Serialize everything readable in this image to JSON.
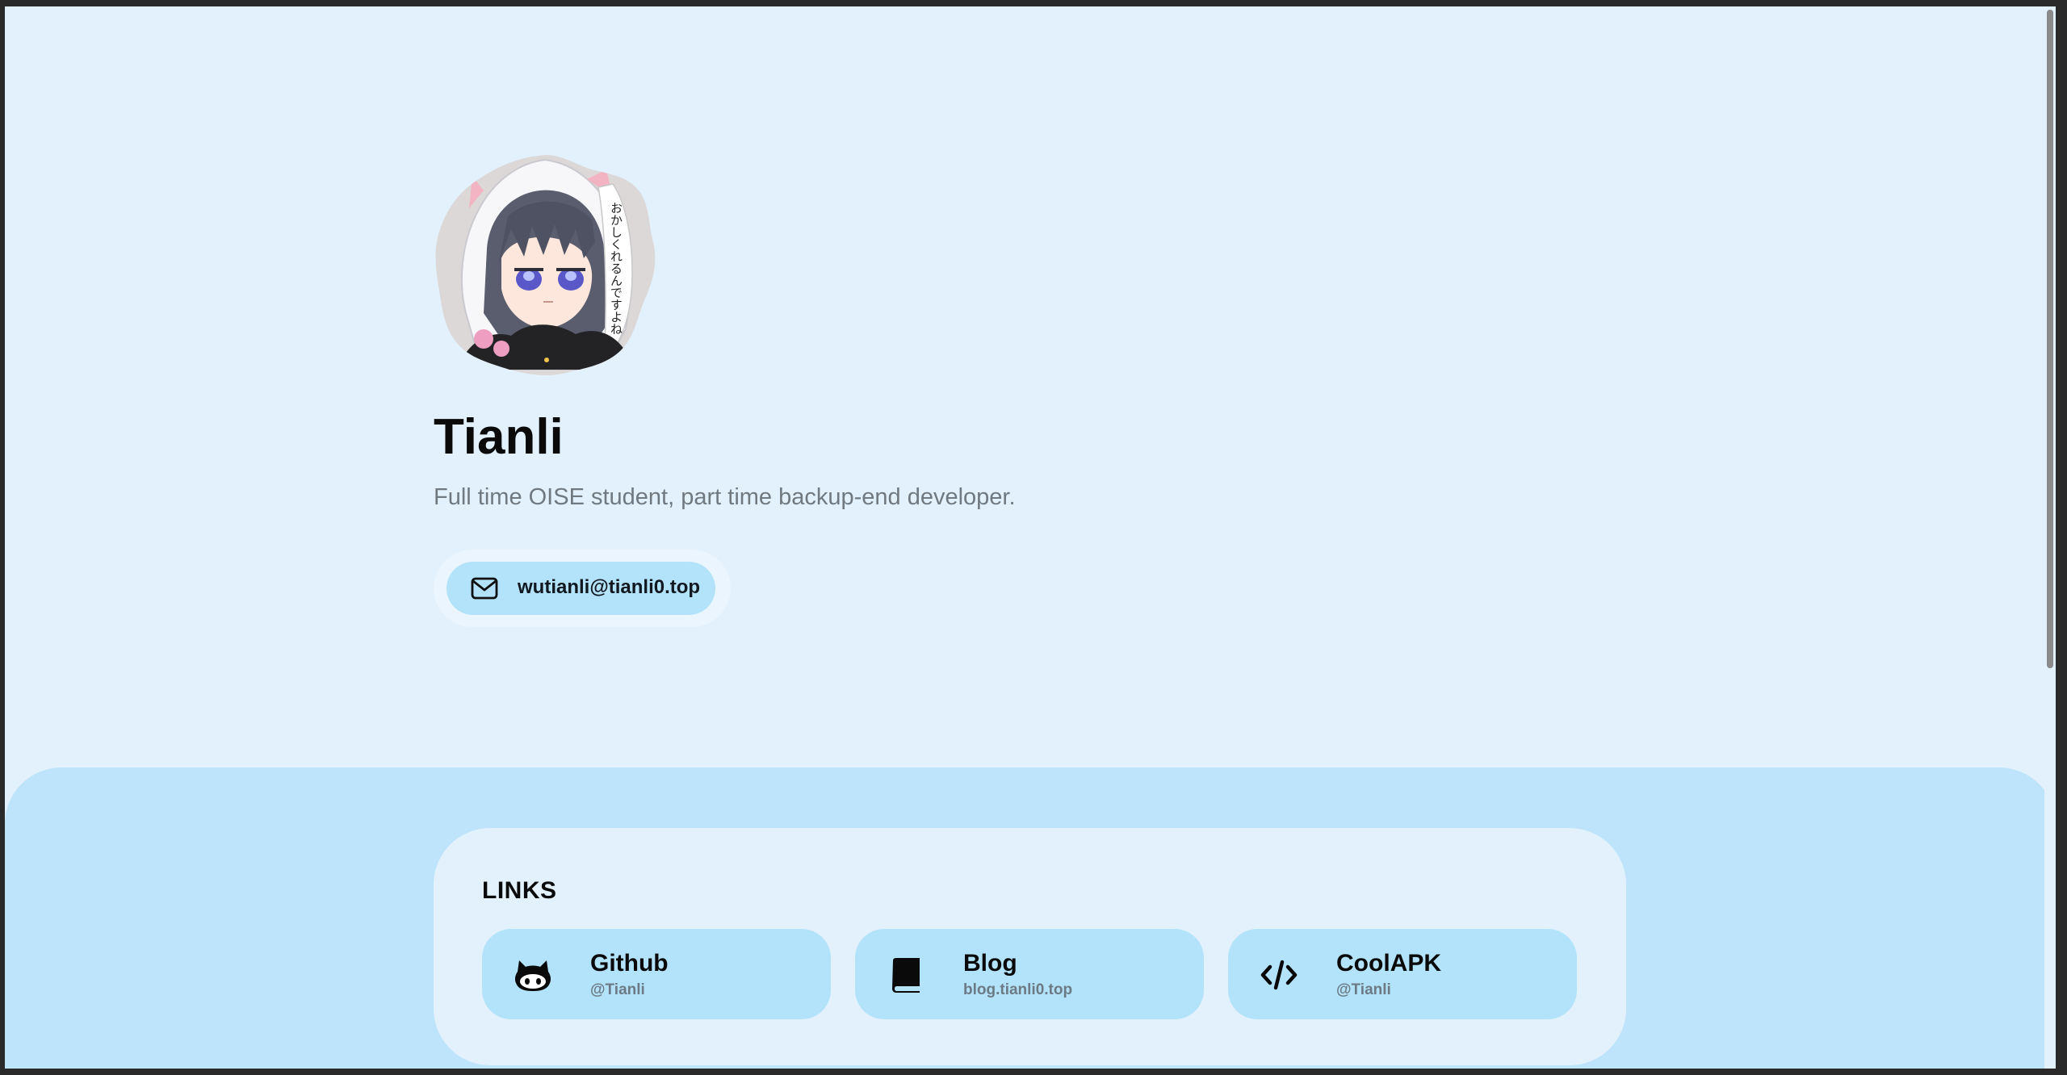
{
  "profile": {
    "name": "Tianli",
    "bio": "Full time OISE student, part time backup-end developer.",
    "avatar_caption": "おかしくれるんですよね",
    "email": "wutianli@tianli0.top"
  },
  "links": {
    "title": "LINKS",
    "items": [
      {
        "name": "Github",
        "sub": "@Tianli",
        "icon": "github-icon"
      },
      {
        "name": "Blog",
        "sub": "blog.tianli0.top",
        "icon": "book-icon"
      },
      {
        "name": "CoolAPK",
        "sub": "@Tianli",
        "icon": "code-icon"
      }
    ]
  },
  "colors": {
    "page_background": "#e2f1fc",
    "section_background": "#bde4fb",
    "button_background": "#b3e3fa",
    "text_primary": "#0a0a0a",
    "text_muted": "#707980"
  }
}
